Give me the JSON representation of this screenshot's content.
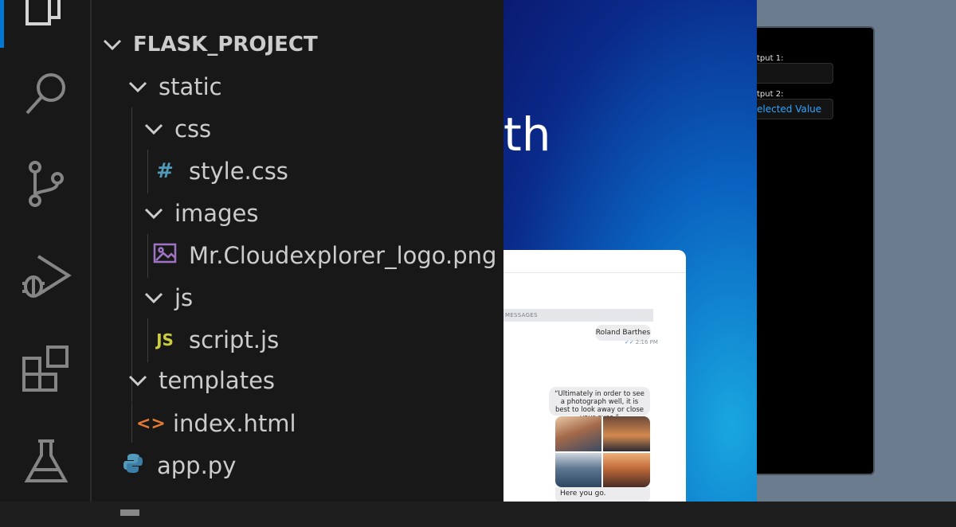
{
  "explorer": {
    "project": "FLASK_PROJECT",
    "items": {
      "static": "static",
      "css": "css",
      "style_css": "style.css",
      "images": "images",
      "logo_png": "Mr.Cloudexplorer_logo.png",
      "js": "js",
      "script_js": "script.js",
      "templates": "templates",
      "index_html": "index.html",
      "app_py": "app.py"
    },
    "file_icons": {
      "css": "#",
      "js": "JS",
      "html": "<>"
    }
  },
  "activity_icons": [
    "explorer-icon",
    "search-icon",
    "source-control-icon",
    "run-debug-icon",
    "extensions-icon",
    "testing-icon"
  ],
  "hero": {
    "partial_heading": "th"
  },
  "chat": {
    "section_label": "MESSAGES",
    "msg1": "Roland Barthes",
    "msg1_time": "2:16 PM",
    "quote": "“Ultimately in order to see a photograph well, it is best to look away or close your eyes.”",
    "caption": "Here you go."
  },
  "panel": {
    "output1_label": "tput 1:",
    "output1_value": "",
    "output2_label": "tput 2:",
    "output2_value": "elected Value"
  },
  "colors": {
    "vscode_bg": "#181818",
    "accent": "#0078d4",
    "css_icon": "#519aba",
    "js_icon": "#cbcb41",
    "html_icon": "#e37933",
    "python_icon": "#519aba",
    "png_icon": "#a074c4",
    "panel_value": "#2fa4ff"
  }
}
